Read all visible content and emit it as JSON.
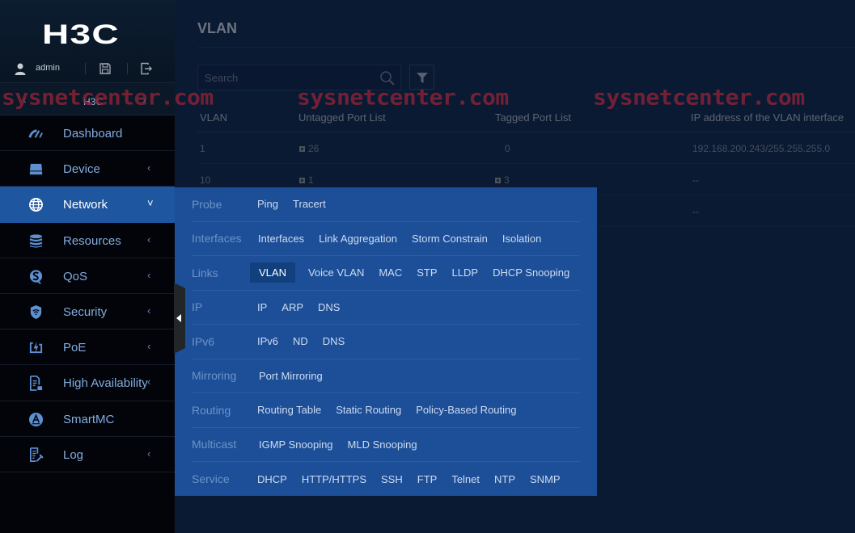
{
  "sidebar": {
    "logo": "H3C",
    "user": "admin",
    "switcher": {
      "label": "H3C",
      "prev": "‹",
      "next": "›"
    },
    "items": [
      {
        "label": "Dashboard",
        "icon": "gauge-icon",
        "arrow": ""
      },
      {
        "label": "Device",
        "icon": "drive-icon",
        "arrow": "‹"
      },
      {
        "label": "Network",
        "icon": "globe-icon",
        "arrow": "˅",
        "active": true
      },
      {
        "label": "Resources",
        "icon": "database-icon",
        "arrow": "‹"
      },
      {
        "label": "QoS",
        "icon": "qos-icon",
        "arrow": "‹"
      },
      {
        "label": "Security",
        "icon": "shield-wifi-icon",
        "arrow": "‹"
      },
      {
        "label": "PoE",
        "icon": "power-bolt-icon",
        "arrow": "‹"
      },
      {
        "label": "High Availability",
        "icon": "document-lock-icon",
        "arrow": "‹"
      },
      {
        "label": "SmartMC",
        "icon": "smartmc-icon",
        "arrow": ""
      },
      {
        "label": "Log",
        "icon": "log-edit-icon",
        "arrow": "‹"
      }
    ]
  },
  "main": {
    "title": "VLAN",
    "search": {
      "placeholder": "Search",
      "value": ""
    },
    "table": {
      "columns": [
        "VLAN",
        "Untagged Port List",
        "Tagged Port List",
        "IP address of the VLAN interface"
      ],
      "rows": [
        {
          "vlan": "1",
          "untagged": "26",
          "untagged_expand": true,
          "tagged": "0",
          "tagged_expand": false,
          "ip": "192.168.200.243/255.255.255.0"
        },
        {
          "vlan": "10",
          "untagged": "1",
          "untagged_expand": true,
          "tagged": "3",
          "tagged_expand": true,
          "ip": "--"
        },
        {
          "vlan": "",
          "untagged": "",
          "tagged": "",
          "ip": "--"
        }
      ]
    }
  },
  "watermark": "sysnetcenter.com",
  "mega_menu": {
    "rows": [
      {
        "category": "Probe",
        "links": [
          "Ping",
          "Tracert"
        ]
      },
      {
        "category": "Interfaces",
        "links": [
          "Interfaces",
          "Link Aggregation",
          "Storm Constrain",
          "Isolation"
        ]
      },
      {
        "category": "Links",
        "links": [
          "VLAN",
          "Voice VLAN",
          "MAC",
          "STP",
          "LLDP",
          "DHCP Snooping"
        ],
        "active": "VLAN"
      },
      {
        "category": "IP",
        "links": [
          "IP",
          "ARP",
          "DNS"
        ]
      },
      {
        "category": "IPv6",
        "links": [
          "IPv6",
          "ND",
          "DNS"
        ]
      },
      {
        "category": "Mirroring",
        "links": [
          "Port Mirroring"
        ]
      },
      {
        "category": "Routing",
        "links": [
          "Routing Table",
          "Static Routing",
          "Policy-Based Routing"
        ]
      },
      {
        "category": "Multicast",
        "links": [
          "IGMP Snooping",
          "MLD Snooping"
        ]
      },
      {
        "category": "Service",
        "links": [
          "DHCP",
          "HTTP/HTTPS",
          "SSH",
          "FTP",
          "Telnet",
          "NTP",
          "SNMP"
        ]
      }
    ]
  },
  "colors": {
    "accent": "#1f56a0",
    "menu_bg": "#1c4f98",
    "active_link_bg": "#12407f",
    "watermark": "#8a2236"
  }
}
